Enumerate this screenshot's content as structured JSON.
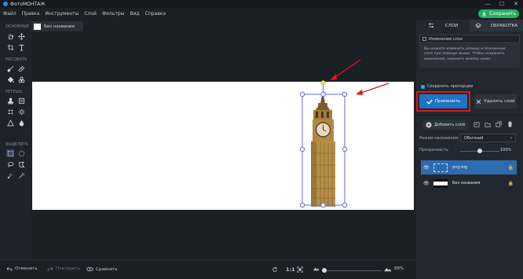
{
  "app": {
    "title": "ФотоМОНТАЖ"
  },
  "window_controls": {
    "minimize": "—",
    "maximize": "☐",
    "close": "✕"
  },
  "menu": [
    "Файл",
    "Правка",
    "Инструменты",
    "Слой",
    "Фильтры",
    "Вид",
    "Справка"
  ],
  "header": {
    "save_label": "Сохранить"
  },
  "toolbar": {
    "sections": {
      "basic": "ОСНОВНЫЕ",
      "draw": "РИСОВАТЬ",
      "retouch": "РЕТУШЬ",
      "select": "ВЫДЕЛИТЬ"
    }
  },
  "document": {
    "tab_name": "Без названия"
  },
  "bottom": {
    "undo": "Отменить",
    "redo": "Повторить",
    "compare": "Сравнить",
    "actual_size": "1:1",
    "zoom": "88%"
  },
  "right_panel": {
    "tab_layers": "СЛОИ",
    "tab_processing": "ОБРАБОТКА",
    "info_header": "Изменение слоя",
    "info_text": "Вы можете изменить размер и положение слоя при помощи мыши. Чтобы сохранить изменения, нажмите кнопку ниже.",
    "keep_ratio": "Сохранять пропорции",
    "apply": "Применить",
    "delete_layer": "Удалить слой",
    "add_layer": "Добавить слой",
    "blend_label": "Режим наложения:",
    "blend_value": "Обычный",
    "opacity_label": "Прозрачность",
    "opacity_value": "100%",
    "layers": [
      {
        "name": "png-big",
        "selected": true
      },
      {
        "name": "Без названия",
        "selected": false
      }
    ]
  },
  "colors": {
    "accent": "#2074c4",
    "save": "#27ae60",
    "highlight": "#e01818",
    "selection": "#6b6bd6"
  }
}
